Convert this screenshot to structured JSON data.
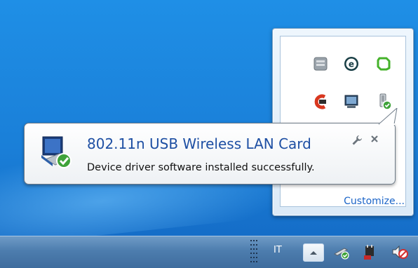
{
  "notification": {
    "title": "802.11n USB Wireless LAN Card",
    "message": "Device driver software installed successfully."
  },
  "tray_flyout": {
    "customize_label": "Customize...",
    "icons": [
      "generic-app-icon",
      "eset-icon",
      "green-sync-icon",
      "ccleaner-icon",
      "monitor-icon",
      "usb-device-check-icon"
    ]
  },
  "taskbar": {
    "language": "IT",
    "icons": [
      "show-hidden-icons-button",
      "usb-driver-check-icon",
      "power-plug-icon",
      "volume-muted-icon"
    ]
  },
  "colors": {
    "title_blue": "#1e4fa3",
    "link_blue": "#1a64c8",
    "desktop_blue": "#1a7fd8"
  }
}
